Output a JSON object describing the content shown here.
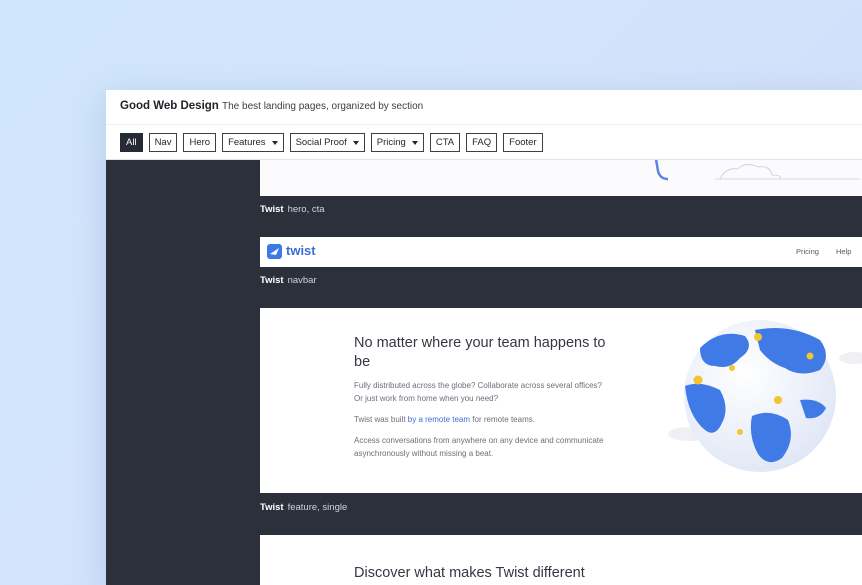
{
  "app": {
    "brand": "Good Web Design",
    "tagline": "The best landing pages, organized by section"
  },
  "filters": [
    {
      "label": "All",
      "active": true,
      "dropdown": false
    },
    {
      "label": "Nav",
      "active": false,
      "dropdown": false
    },
    {
      "label": "Hero",
      "active": false,
      "dropdown": false
    },
    {
      "label": "Features",
      "active": false,
      "dropdown": true
    },
    {
      "label": "Social Proof",
      "active": false,
      "dropdown": true
    },
    {
      "label": "Pricing",
      "active": false,
      "dropdown": true
    },
    {
      "label": "CTA",
      "active": false,
      "dropdown": false
    },
    {
      "label": "FAQ",
      "active": false,
      "dropdown": false
    },
    {
      "label": "Footer",
      "active": false,
      "dropdown": false
    }
  ],
  "examples": [
    {
      "site": "Twist",
      "tags": "hero, cta"
    },
    {
      "site": "Twist",
      "tags": "navbar"
    },
    {
      "site": "Twist",
      "tags": "feature, single"
    }
  ],
  "navbar_preview": {
    "logo_text": "twist",
    "links": [
      "Pricing",
      "Help"
    ]
  },
  "feature_preview": {
    "title": "No matter where your team happens to be",
    "p1": "Fully distributed across the globe? Collaborate across several offices? Or just work from home when you need?",
    "p2_before": "Twist was built ",
    "p2_link": "by a remote team",
    "p2_after": " for remote teams.",
    "p3": "Access conversations from anywhere on any device and communicate asynchronously without missing a beat."
  },
  "next_preview": {
    "title": "Discover what makes Twist different"
  },
  "colors": {
    "accent": "#3f6fd6",
    "dark_bg": "#2b303b",
    "globe": "#3f7ae6"
  }
}
